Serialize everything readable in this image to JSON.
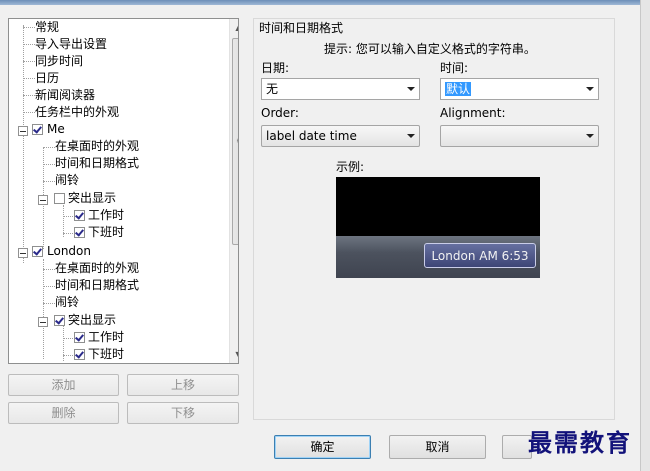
{
  "tree": {
    "items": [
      {
        "label": "常规"
      },
      {
        "label": "导入导出设置"
      },
      {
        "label": "同步时间"
      },
      {
        "label": "日历"
      },
      {
        "label": "新闻阅读器"
      },
      {
        "label": "任务栏中的外观"
      },
      {
        "label": "Me",
        "checked": true
      },
      {
        "label": "在桌面时的外观"
      },
      {
        "label": "时间和日期格式"
      },
      {
        "label": "闹铃"
      },
      {
        "label": "突出显示",
        "checked": false
      },
      {
        "label": "工作时",
        "checked": true
      },
      {
        "label": "下班时",
        "checked": true
      },
      {
        "label": "London",
        "checked": true
      },
      {
        "label": "在桌面时的外观"
      },
      {
        "label": "时间和日期格式"
      },
      {
        "label": "闹铃"
      },
      {
        "label": "突出显示",
        "checked": true
      },
      {
        "label": "工作时",
        "checked": true
      },
      {
        "label": "下班时",
        "checked": true
      }
    ]
  },
  "left_buttons": {
    "add": "添加",
    "move_up": "上移",
    "delete": "删除",
    "move_down": "下移"
  },
  "panel": {
    "title": "时间和日期格式",
    "hint": "提示: 您可以输入自定义格式的字符串。",
    "date_label": "日期:",
    "date_value": "无",
    "time_label": "时间:",
    "time_value": "默认",
    "order_label": "Order:",
    "order_value": "label date time",
    "alignment_label": "Alignment:",
    "alignment_value": "",
    "example_label": "示例:",
    "example_clock": "London AM 6:53"
  },
  "footer": {
    "ok": "确定",
    "cancel": "取消"
  },
  "watermark": "最需教育"
}
